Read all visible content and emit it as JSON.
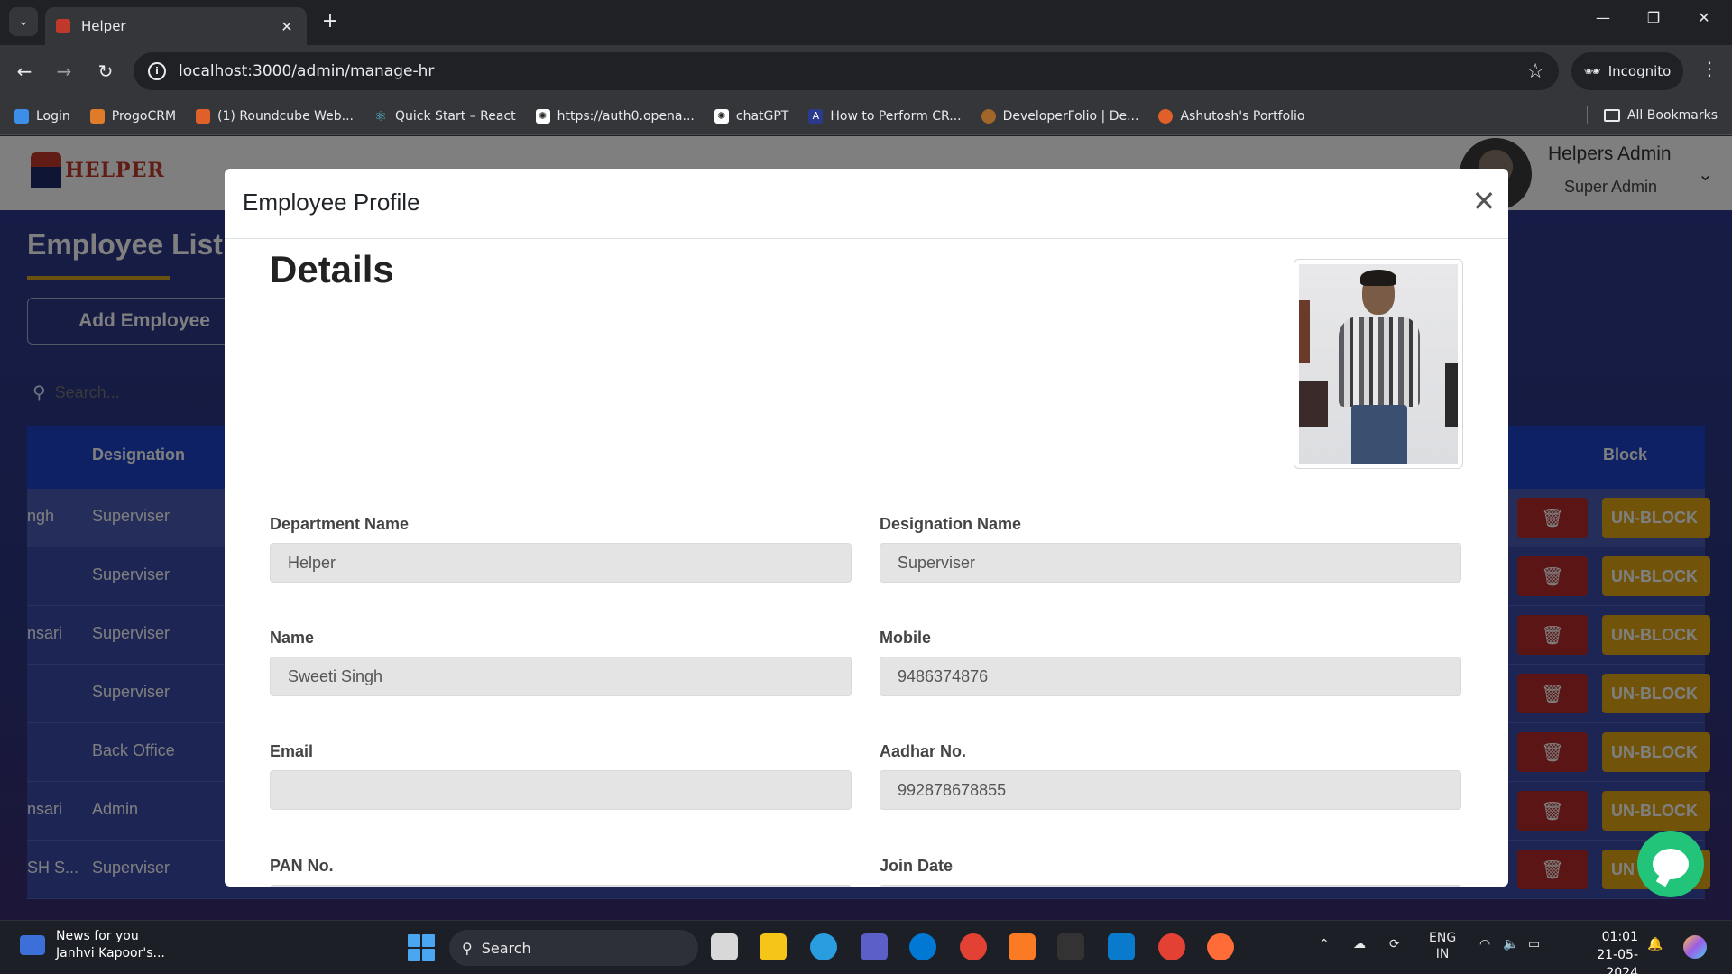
{
  "browser": {
    "tab_title": "Helper",
    "tab_close": "✕",
    "new_tab": "+",
    "url": "localhost:3000/admin/manage-hr",
    "incognito_label": "Incognito",
    "bookmarks": [
      {
        "label": "Login",
        "icon": "login-icon",
        "color": "#3d8ee8"
      },
      {
        "label": "ProgoCRM",
        "icon": "progocrm-icon",
        "color": "#e07b2a"
      },
      {
        "label": "(1) Roundcube Web...",
        "icon": "roundcube-icon",
        "color": "#e0602a"
      },
      {
        "label": "Quick Start – React",
        "icon": "react-icon",
        "color": "#58c4dc"
      },
      {
        "label": "https://auth0.opena...",
        "icon": "openai-icon",
        "color": "#555555"
      },
      {
        "label": "chatGPT",
        "icon": "openai-icon",
        "color": "#555555"
      },
      {
        "label": "How to Perform CR...",
        "icon": "angular-icon",
        "color": "#2b3a8c"
      },
      {
        "label": "DeveloperFolio | De...",
        "icon": "avatar-icon",
        "color": "#a0662a"
      },
      {
        "label": "Ashutosh's Portfolio",
        "icon": "portfolio-icon",
        "color": "#e0602a"
      }
    ],
    "all_bookmarks": "All Bookmarks"
  },
  "app": {
    "logo_text": "HELPER",
    "admin_name": "Helpers Admin",
    "admin_role": "Super Admin",
    "page_title": "Employee List",
    "add_employee": "Add Employee",
    "search_placeholder": "Search...",
    "columns": {
      "designation": "Designation",
      "block": "Block"
    },
    "rows": [
      {
        "name": "ngh",
        "designation": "Superviser",
        "block": "UN-BLOCK"
      },
      {
        "name": "",
        "designation": "Superviser",
        "block": "UN-BLOCK"
      },
      {
        "name": "nsari",
        "designation": "Superviser",
        "block": "UN-BLOCK"
      },
      {
        "name": "",
        "designation": "Superviser",
        "block": "UN-BLOCK"
      },
      {
        "name": "",
        "designation": "Back Office",
        "block": "UN-BLOCK"
      },
      {
        "name": "nsari",
        "designation": "Admin",
        "block": "UN-BLOCK"
      },
      {
        "name": "SH S...",
        "designation": "Superviser",
        "block": "UN"
      }
    ]
  },
  "modal": {
    "title": "Employee Profile",
    "close": "✕",
    "heading": "Details",
    "fields": {
      "department": {
        "label": "Department Name",
        "value": "Helper"
      },
      "designation": {
        "label": "Designation Name",
        "value": "Superviser"
      },
      "name": {
        "label": "Name",
        "value": "Sweeti Singh"
      },
      "mobile": {
        "label": "Mobile",
        "value": "9486374876"
      },
      "email": {
        "label": "Email",
        "value": ""
      },
      "aadhar": {
        "label": "Aadhar No.",
        "value": "992878678855"
      },
      "pan": {
        "label": "PAN No."
      },
      "join_date": {
        "label": "Join Date"
      }
    }
  },
  "taskbar": {
    "news_title": "News for you",
    "news_sub": "Janhvi Kapoor's...",
    "search_label": "Search",
    "lang_1": "ENG",
    "lang_2": "IN",
    "time": "01:01",
    "date": "21-05-2024"
  }
}
